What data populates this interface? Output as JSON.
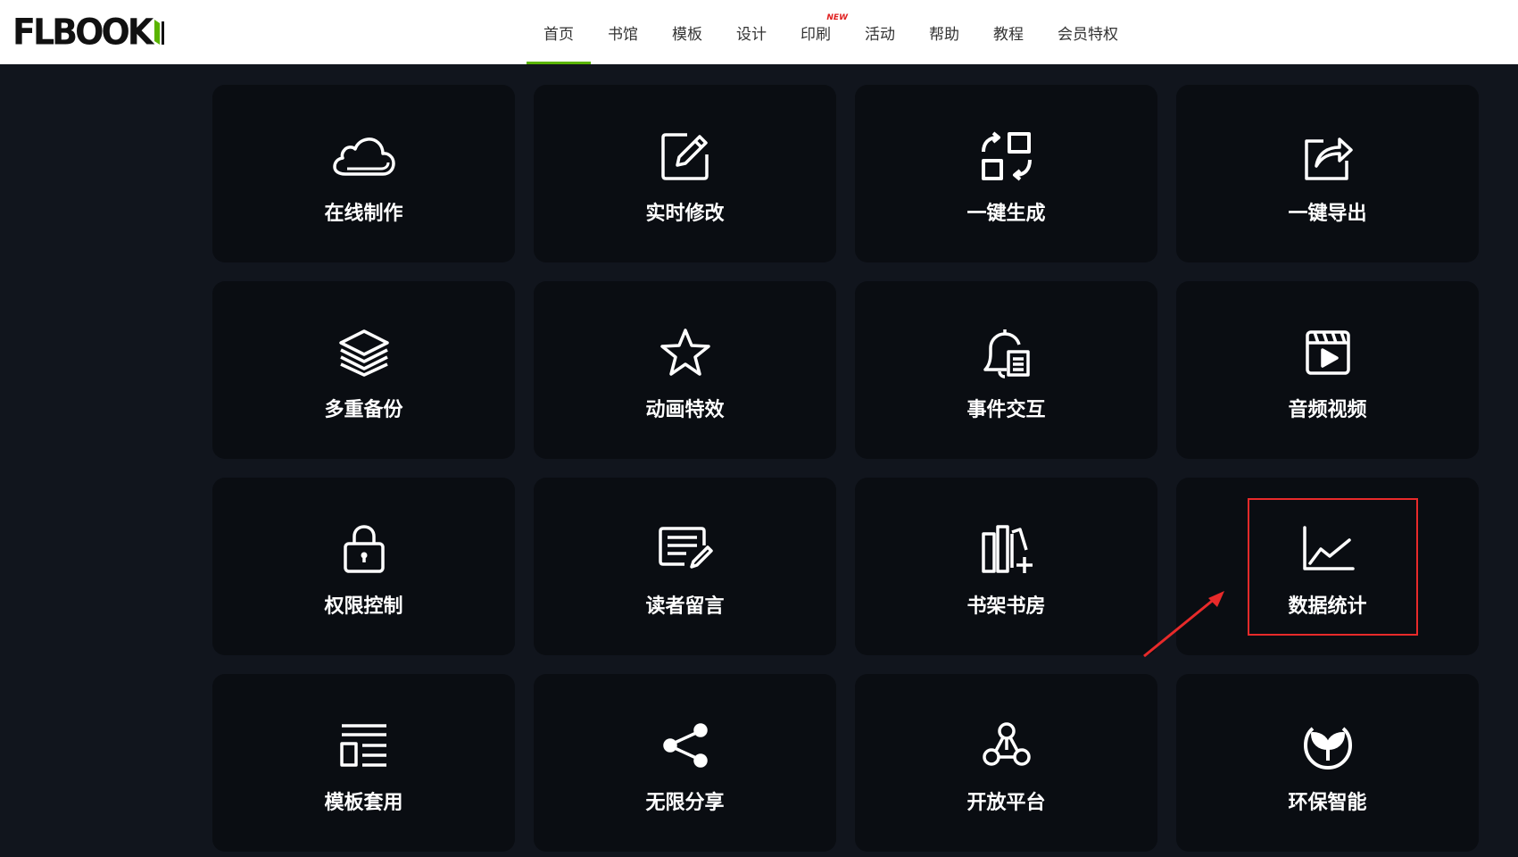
{
  "header": {
    "logo_text": "FLBOOK",
    "nav": [
      {
        "label": "首页",
        "active": true
      },
      {
        "label": "书馆"
      },
      {
        "label": "模板"
      },
      {
        "label": "设计"
      },
      {
        "label": "印刷",
        "badge": "NEW"
      },
      {
        "label": "活动"
      },
      {
        "label": "帮助"
      },
      {
        "label": "教程"
      },
      {
        "label": "会员特权"
      }
    ]
  },
  "features": [
    {
      "label": "在线制作",
      "icon": "cloud-icon"
    },
    {
      "label": "实时修改",
      "icon": "edit-icon"
    },
    {
      "label": "一键生成",
      "icon": "generate-icon"
    },
    {
      "label": "一键导出",
      "icon": "export-icon"
    },
    {
      "label": "多重备份",
      "icon": "layers-icon"
    },
    {
      "label": "动画特效",
      "icon": "star-icon"
    },
    {
      "label": "事件交互",
      "icon": "bell-doc-icon"
    },
    {
      "label": "音频视频",
      "icon": "video-icon"
    },
    {
      "label": "权限控制",
      "icon": "lock-icon"
    },
    {
      "label": "读者留言",
      "icon": "comment-icon"
    },
    {
      "label": "书架书房",
      "icon": "bookshelf-icon"
    },
    {
      "label": "数据统计",
      "icon": "chart-icon",
      "highlighted": true
    },
    {
      "label": "模板套用",
      "icon": "template-icon"
    },
    {
      "label": "无限分享",
      "icon": "share-icon"
    },
    {
      "label": "开放平台",
      "icon": "network-icon"
    },
    {
      "label": "环保智能",
      "icon": "eco-icon"
    }
  ],
  "colors": {
    "accent_green": "#5ab400",
    "highlight_red": "#e82a2a",
    "card_bg": "#0a0d12",
    "page_bg": "#11151d"
  }
}
